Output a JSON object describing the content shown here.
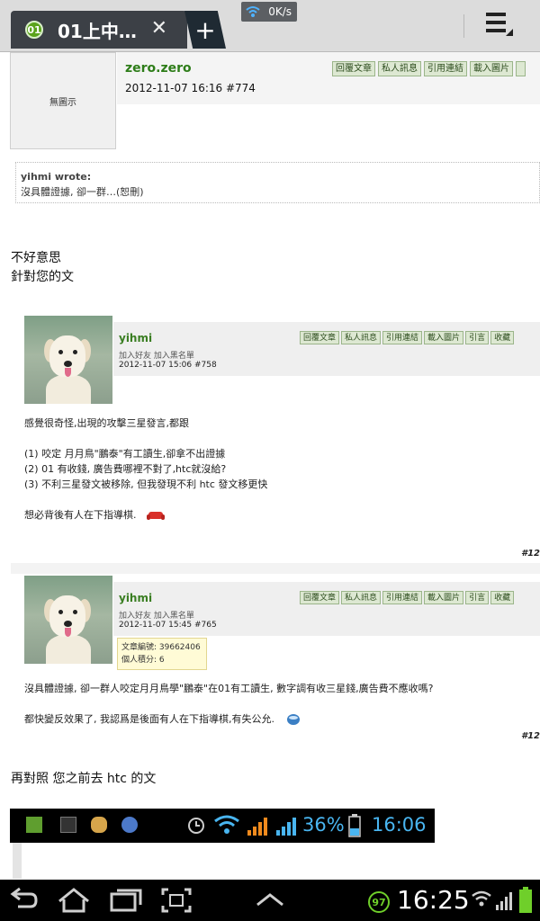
{
  "browser": {
    "tab_title": "01上中…",
    "tab_favicon_text": "01",
    "close_glyph": "✕",
    "new_tab_glyph": "+",
    "net_speed": "0K/s"
  },
  "post": {
    "avatar_alt": "無圖示",
    "author": "zero.zero",
    "date_line": "2012-11-07 16:16  #774",
    "actions": [
      "回覆文章",
      "私人訊息",
      "引用連結",
      "載入圖片"
    ]
  },
  "quote": {
    "author_line": "yihmi wrote:",
    "text": "沒具體證據, 卻一群…(恕刪)"
  },
  "body": {
    "line1": "不好意思",
    "line2": "針對您的文",
    "line3": "再對照 您之前去 htc 的文"
  },
  "embedded": {
    "posts": [
      {
        "author": "yihmi",
        "links": "加入好友  加入黑名單",
        "date_line": "2012-11-07 15:06  #758",
        "actions": [
          "回覆文章",
          "私人訊息",
          "引用連結",
          "載入圖片",
          "引言",
          "收藏"
        ],
        "paragraphs": [
          "感覺很奇怪,出現的攻擊三星發言,都跟",
          "",
          "(1) 咬定 月月鳥\"鵬泰\"有工讀生,卻拿不出證據",
          "(2) 01 有收錢, 廣告費哪裡不對了,htc就沒給?",
          "(3) 不利三星發文被移除, 但我發現不利 htc 發文移更快",
          "",
          "想必背後有人在下指導棋."
        ],
        "page_tag": "#12"
      },
      {
        "author": "yihmi",
        "links": "加入好友  加入黑名單",
        "date_line": "2012-11-07 15:45  #765",
        "tooltip_line1": "文章編號: 39662406",
        "tooltip_line2": "個人積分: 6",
        "actions": [
          "回覆文章",
          "私人訊息",
          "引用連結",
          "載入圖片",
          "引言",
          "收藏"
        ],
        "paragraphs": [
          "沒具體證據, 卻一群人咬定月月鳥學\"鵬泰\"在01有工讀生, 數字調有收三星錢,廣告費不應收嗎?",
          "",
          "都快變反效果了, 我認爲是後面有人在下指導棋,有失公允."
        ],
        "page_tag": "#12"
      }
    ],
    "inner_status": {
      "battery_pct": "36%",
      "time": "16:06"
    }
  },
  "system": {
    "time": "16:25",
    "battery_level": "97"
  }
}
